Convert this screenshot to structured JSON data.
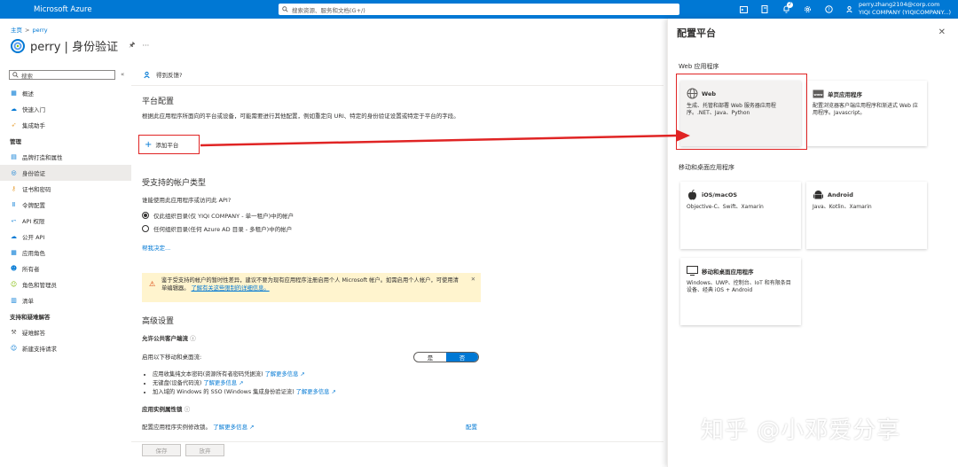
{
  "topbar": {
    "brand": "Microsoft Azure",
    "search_placeholder": "搜索资源、服务和文档(G+/)",
    "notification_count": "2",
    "account_line1": "perry.zhang2104@corp.com",
    "account_line2": "YIQI COMPANY (YIQICOMPANY...)"
  },
  "breadcrumb": {
    "home": "主页",
    "current": "perry"
  },
  "page": {
    "app_name": "perry",
    "separator": "|",
    "blade": "身份验证"
  },
  "sidebar": {
    "search_placeholder": "搜索",
    "items_top": [
      {
        "label": "概述",
        "icon": "overview-icon"
      },
      {
        "label": "快速入门",
        "icon": "quickstart-icon"
      },
      {
        "label": "集成助手",
        "icon": "rocket-icon"
      }
    ],
    "manage_header": "管理",
    "items_manage": [
      {
        "label": "品牌打造和属性",
        "icon": "branding-icon"
      },
      {
        "label": "身份验证",
        "icon": "auth-icon"
      },
      {
        "label": "证书和密码",
        "icon": "key-icon"
      },
      {
        "label": "令牌配置",
        "icon": "token-icon"
      },
      {
        "label": "API 权限",
        "icon": "api-permissions-icon"
      },
      {
        "label": "公开 API",
        "icon": "expose-api-icon"
      },
      {
        "label": "应用角色",
        "icon": "app-roles-icon"
      },
      {
        "label": "所有者",
        "icon": "owners-icon"
      },
      {
        "label": "角色和管理员",
        "icon": "roles-admins-icon"
      },
      {
        "label": "清单",
        "icon": "manifest-icon"
      }
    ],
    "support_header": "支持和疑难解答",
    "items_support": [
      {
        "label": "疑难解答",
        "icon": "wrench-icon"
      },
      {
        "label": "新建支持请求",
        "icon": "support-icon"
      }
    ]
  },
  "main": {
    "feedback": "得到反馈?",
    "platform_title": "平台配置",
    "platform_desc": "根据此应用程序所面向的平台或设备，可能需要进行其他配置，例如重定向 URI、特定的身份验证设置或特定于平台的字段。",
    "add_platform": "添加平台",
    "account_types_title": "受支持的帐户类型",
    "account_question": "谁能使用此应用程序或访问此 API?",
    "radio1": "仅此组织目录(仅 YIQI COMPANY - 单一租户)中的帐户",
    "radio2": "任何组织目录(任何 Azure AD 目录 - 多租户)中的帐户",
    "help_link": "帮我决定...",
    "warning_text": "鉴于受支持的帐户的暂时性差异，建议不要为现有应用程序注册启用个人 Microsoft 帐户。如需启用个人帐户，可使用清单编辑器。",
    "warning_link": "了解有关这些限制的详细信息。",
    "advanced_title": "高级设置",
    "public_client_title": "允许公共客户端流",
    "enable_flows": "启用以下移动和桌面流:",
    "toggle_yes": "是",
    "toggle_no": "否",
    "bullet1": "应用收集纯文本密码(资源所有者密码凭据流)",
    "bullet2": "无键盘(设备代码流)",
    "bullet3": "加入域的 Windows 的 SSO (Windows 集成身份验证流)",
    "learn_more": "了解更多信息",
    "instance_title": "应用实例属性锁",
    "instance_desc": "配置应用程序实例修改锁。",
    "configure": "配置",
    "save": "保存",
    "discard": "放弃"
  },
  "panel": {
    "title": "配置平台",
    "web_section": "Web 应用程序",
    "mobile_section": "移动和桌面应用程序",
    "cards": {
      "web": {
        "title": "Web",
        "desc": "生成、托管和部署 Web 服务器应用程序。.NET、Java、Python"
      },
      "spa": {
        "title": "单页应用程序",
        "desc": "配置浏览器客户端应用程序和渐进式 Web 应用程序。Javascript。"
      },
      "ios": {
        "title": "iOS/macOS",
        "desc": "Objective-C、Swift、Xamarin"
      },
      "android": {
        "title": "Android",
        "desc": "Java、Kotlin、Xamarin"
      },
      "desktop": {
        "title": "移动和桌面应用程序",
        "desc": "Windows、UWP、控制台、IoT 和有限条目设备、经典 iOS + Android"
      }
    }
  },
  "watermark": "知乎 @小邓爱分享",
  "colors": {
    "accent": "#0078d4",
    "annotation": "#e02424",
    "warning_bg": "#fff4ce"
  }
}
